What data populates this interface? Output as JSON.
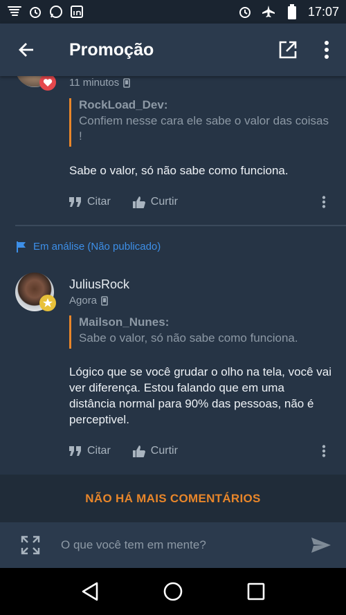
{
  "status_bar": {
    "time": "17:07",
    "left_icons": [
      "tornado-icon",
      "alarm-icon",
      "whatsapp-icon",
      "linkedin-icon"
    ],
    "right_icons": [
      "alarm-icon",
      "airplane-mode-icon",
      "battery-icon"
    ]
  },
  "app_bar": {
    "title": "Promoção",
    "icons": [
      "back-arrow-icon",
      "open-external-icon",
      "more-vert-icon"
    ]
  },
  "posts": [
    {
      "time": "11 minutos",
      "quote_author": "RockLoad_Dev:",
      "quote_text": "Confiem nesse cara ele sabe o valor das coisas !",
      "body": "Sabe o valor, só não sabe como funciona.",
      "actions": {
        "quote_label": "Citar",
        "like_label": "Curtir"
      },
      "badge_icon": "heart-icon"
    },
    {
      "moderation_label": "Em análise (Não publicado)",
      "username": "JuliusRock",
      "time": "Agora",
      "quote_author": "Mailson_Nunes:",
      "quote_text": "Sabe o valor, só não sabe como funciona.",
      "body": "Lógico que se você grudar o olho na tela, você vai ver diferença. Estou falando que em uma distância normal para 90% das pessoas, não é perceptivel.",
      "actions": {
        "quote_label": "Citar",
        "like_label": "Curtir"
      },
      "badge_icon": "star-icon"
    }
  ],
  "footer": {
    "no_more_label": "NÃO HÁ MAIS COMENTÁRIOS"
  },
  "composer": {
    "placeholder": "O que você tem em mente?",
    "value": ""
  },
  "nav": [
    "back-triangle-icon",
    "home-circle-icon",
    "recents-square-icon"
  ],
  "colors": {
    "accent": "#e8862a",
    "link": "#3d8fe8",
    "background": "#263445",
    "app_bar": "#2b3a4d"
  }
}
